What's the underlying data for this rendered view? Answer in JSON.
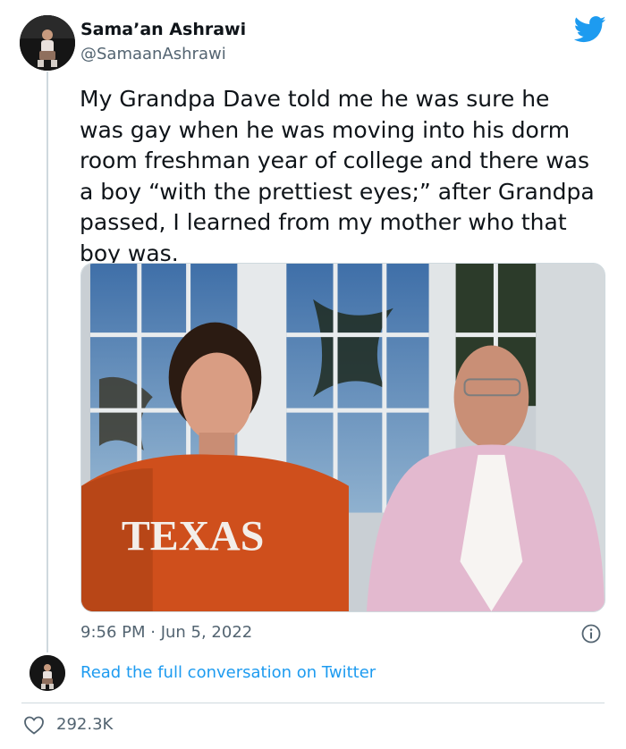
{
  "author": {
    "display_name": "Sama’an Ashrawi",
    "handle": "@SamaanAshrawi"
  },
  "tweet": {
    "text": "My Grandpa Dave told me he was sure he\nwas gay when he was moving into his dorm\nroom freshman year of college and there was\na boy “with the prettiest eyes;” after Grandpa\npassed, I learned from my mother who that\nboy was.",
    "timestamp": "9:56 PM · Jun 5, 2022",
    "photo_shirt_text": "TEXAS"
  },
  "actions": {
    "read_conversation": "Read the full conversation on Twitter",
    "like_count": "292.3K"
  },
  "colors": {
    "twitter_blue": "#1d9bf0",
    "secondary_text": "#536471",
    "divider": "#cfd9de"
  },
  "icons": [
    "twitter-bird-icon",
    "info-icon",
    "heart-icon"
  ]
}
